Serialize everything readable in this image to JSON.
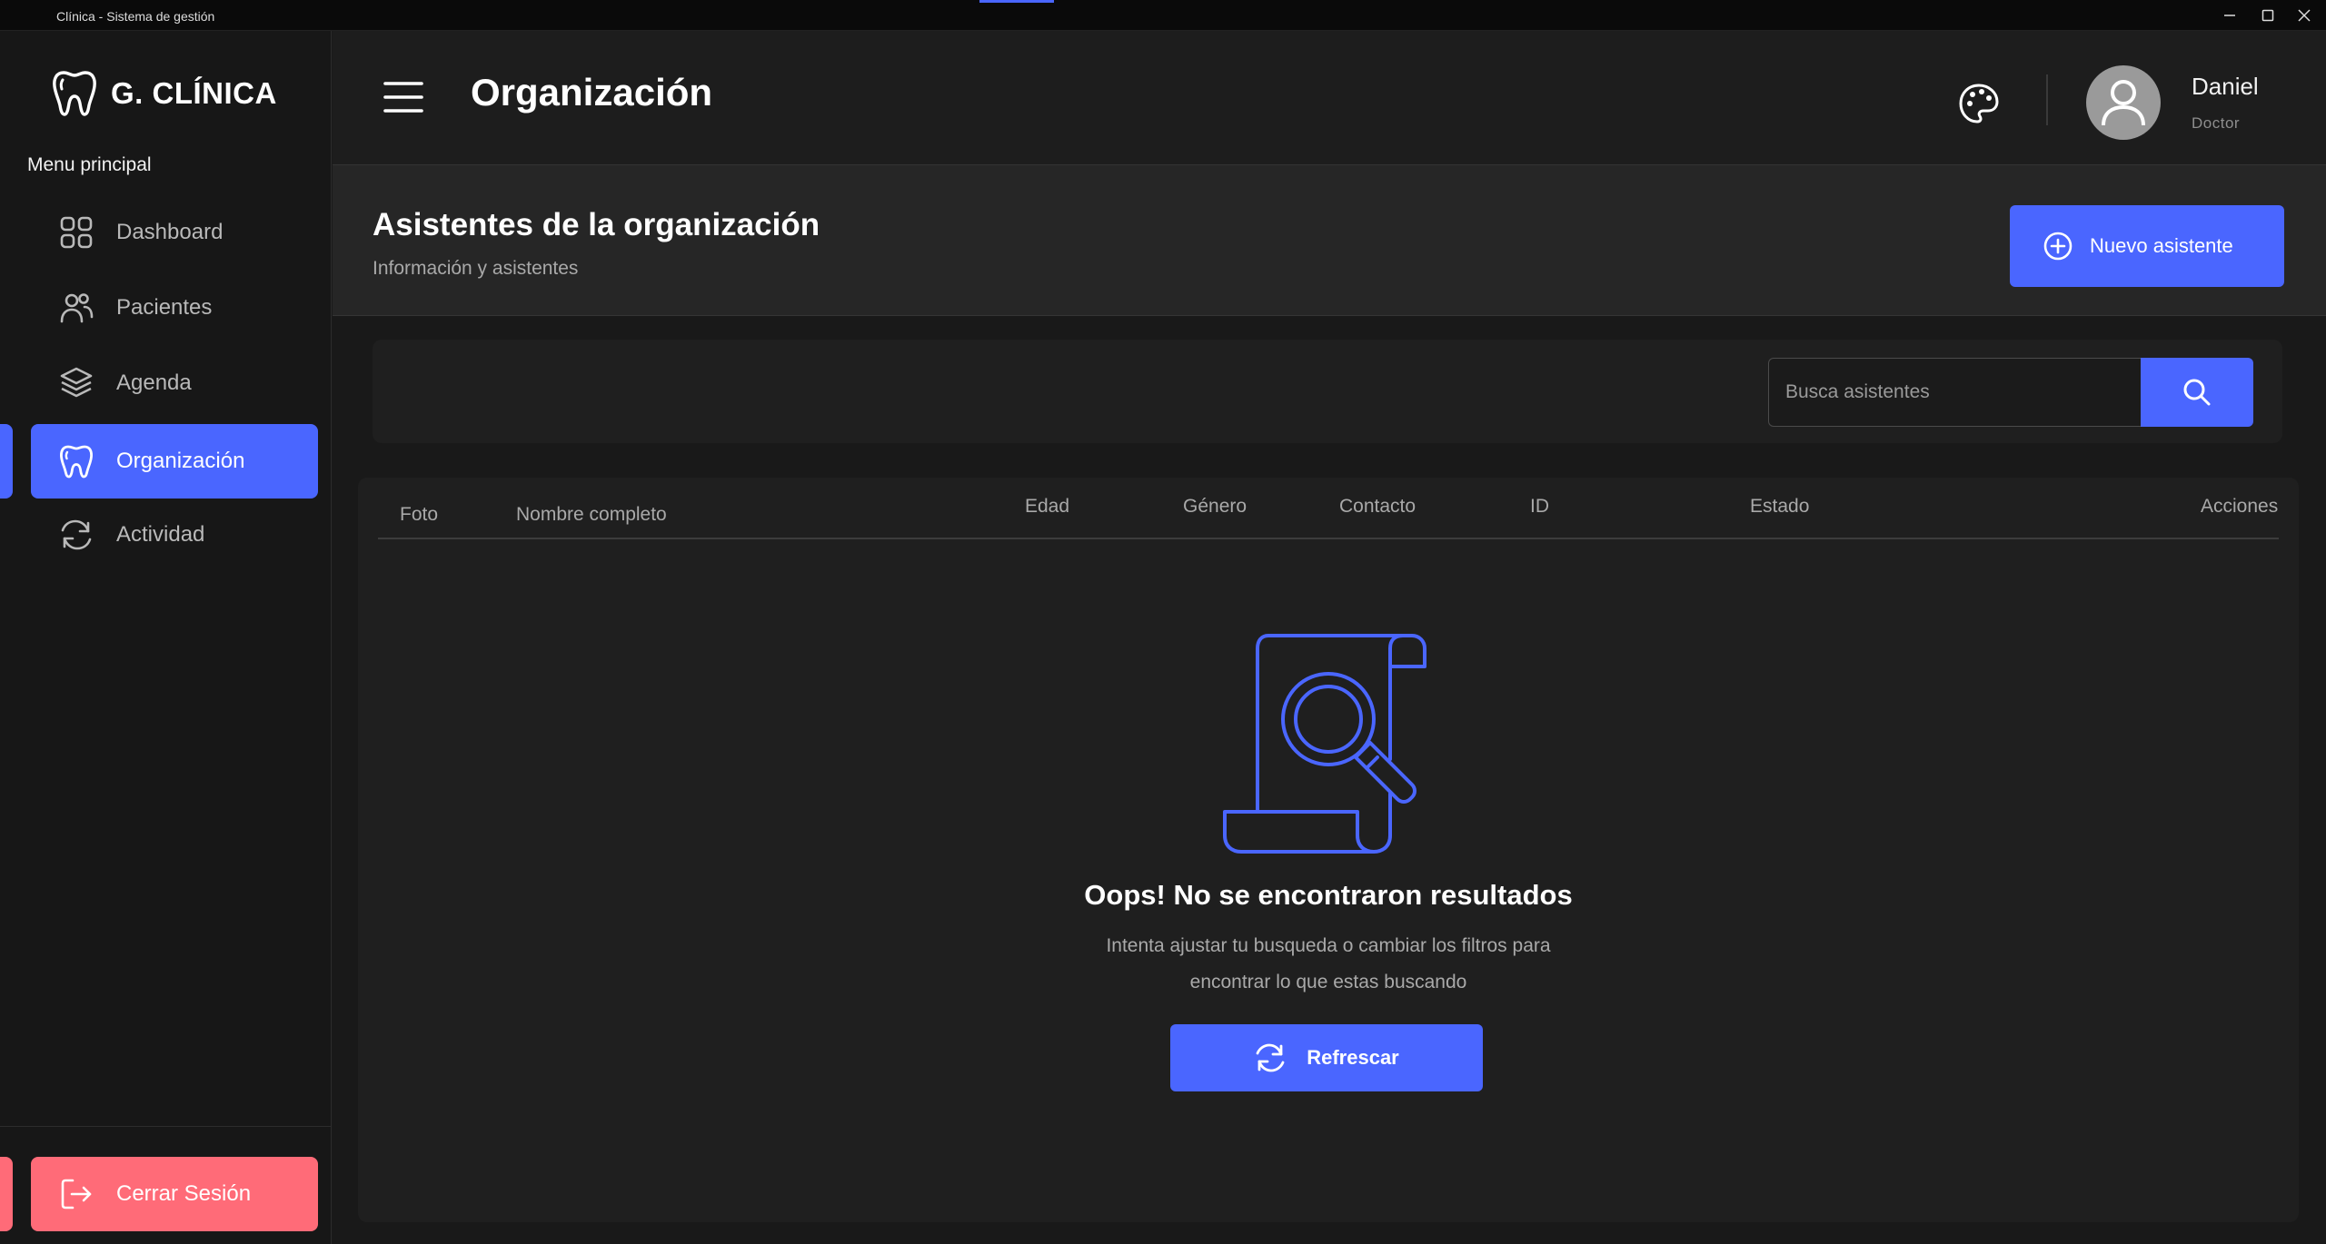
{
  "window": {
    "title": "Clínica - Sistema de gestión"
  },
  "sidebar": {
    "brand": "G. CLÍNICA",
    "menu_label": "Menu principal",
    "items": [
      {
        "label": "Dashboard",
        "icon": "grid-icon"
      },
      {
        "label": "Pacientes",
        "icon": "users-icon"
      },
      {
        "label": "Agenda",
        "icon": "layers-icon"
      },
      {
        "label": "Organización",
        "icon": "tooth-icon",
        "active": true
      },
      {
        "label": "Actividad",
        "icon": "refresh-icon"
      }
    ],
    "logout_label": "Cerrar Sesión"
  },
  "header": {
    "title": "Organización",
    "user": {
      "name": "Daniel",
      "role": "Doctor"
    }
  },
  "section": {
    "title": "Asistentes de la organización",
    "subtitle": "Información y asistentes",
    "new_button": "Nuevo asistente"
  },
  "search": {
    "placeholder": "Busca asistentes"
  },
  "table": {
    "columns": [
      "Foto",
      "Nombre completo",
      "Edad",
      "Género",
      "Contacto",
      "ID",
      "Estado",
      "Acciones"
    ]
  },
  "empty_state": {
    "title": "Oops! No se encontraron resultados",
    "text_line1": "Intenta ajustar tu busqueda o cambiar los filtros para",
    "text_line2": "encontrar lo que estas buscando",
    "button": "Refrescar"
  },
  "colors": {
    "accent": "#4a66ff",
    "danger": "#ff6b78",
    "background": "#191919"
  }
}
